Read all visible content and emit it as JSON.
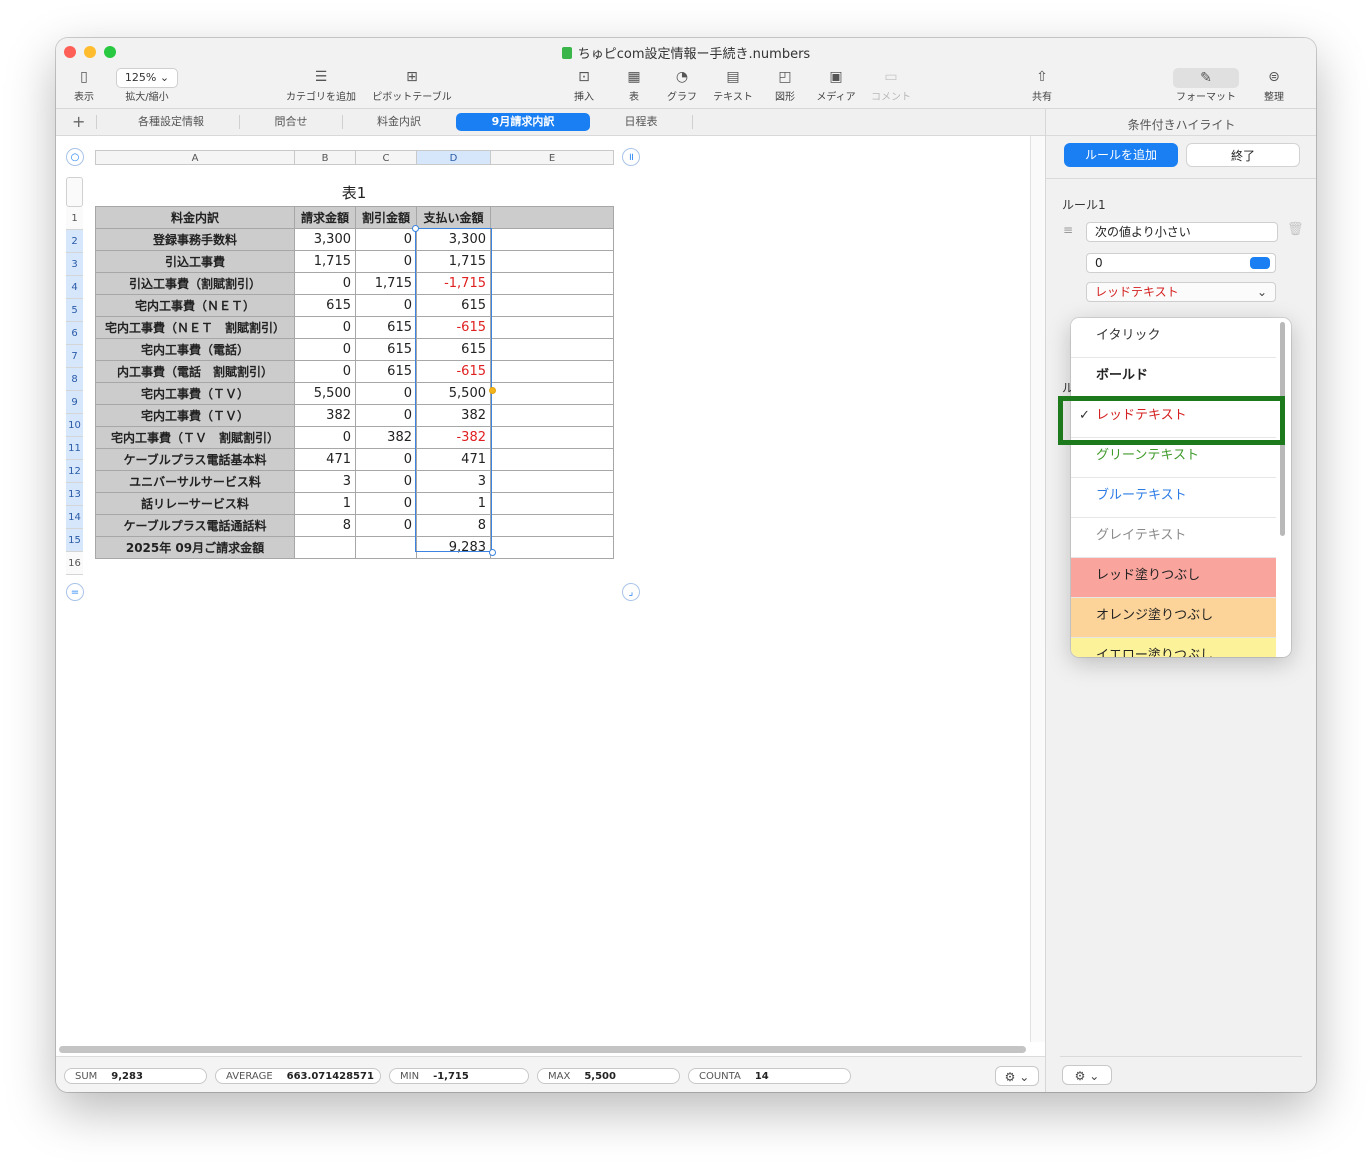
{
  "window": {
    "title": "ちゅピcom設定情報ー手続き.numbers",
    "traffic_colors": [
      "#fe5f57",
      "#febc2e",
      "#28c840"
    ]
  },
  "toolbar": {
    "view": "表示",
    "zoom_value": "125%",
    "zoom_label": "拡大/縮小",
    "add_category": "カテゴリを追加",
    "pivot": "ピボットテーブル",
    "insert": "挿入",
    "table": "表",
    "graph": "グラフ",
    "text": "テキスト",
    "shape": "図形",
    "media": "メディア",
    "comment": "コメント",
    "share": "共有",
    "format": "フォーマット",
    "organize": "整理"
  },
  "tabs": {
    "add": "+",
    "items": [
      "各種設定情報",
      "問合せ",
      "料金内訳",
      "9月請求内訳",
      "日程表"
    ],
    "active_index": 3
  },
  "sheet": {
    "column_headers": [
      "A",
      "B",
      "C",
      "D",
      "E"
    ],
    "selected_column": "D",
    "row_numbers": [
      "1",
      "2",
      "3",
      "4",
      "5",
      "6",
      "7",
      "8",
      "9",
      "10",
      "11",
      "12",
      "13",
      "14",
      "15",
      "16"
    ],
    "selected_rows": [
      "2",
      "3",
      "4",
      "5",
      "6",
      "7",
      "8",
      "9",
      "10",
      "11",
      "12",
      "13",
      "14",
      "15"
    ],
    "table_title": "表1",
    "header": [
      "料金内訳",
      "請求金額",
      "割引金額",
      "支払い金額",
      ""
    ],
    "rows": [
      {
        "label": "登録事務手数料",
        "billed": "3,300",
        "discount": "0",
        "paid": "3,300",
        "paid_negative": false
      },
      {
        "label": "引込工事費",
        "billed": "1,715",
        "discount": "0",
        "paid": "1,715",
        "paid_negative": false
      },
      {
        "label": "引込工事費（割賦割引）",
        "billed": "0",
        "discount": "1,715",
        "paid": "-1,715",
        "paid_negative": true
      },
      {
        "label": "宅内工事費（ＮＥＴ）",
        "billed": "615",
        "discount": "0",
        "paid": "615",
        "paid_negative": false
      },
      {
        "label": "宅内工事費（ＮＥＴ　割賦割引）",
        "billed": "0",
        "discount": "615",
        "paid": "-615",
        "paid_negative": true
      },
      {
        "label": "宅内工事費（電話）",
        "billed": "0",
        "discount": "615",
        "paid": "615",
        "paid_negative": false
      },
      {
        "label": "内工事費（電話　割賦割引）",
        "billed": "0",
        "discount": "615",
        "paid": "-615",
        "paid_negative": true
      },
      {
        "label": "宅内工事費（ＴＶ）",
        "billed": "5,500",
        "discount": "0",
        "paid": "5,500",
        "paid_negative": false
      },
      {
        "label": "宅内工事費（ＴＶ）",
        "billed": "382",
        "discount": "0",
        "paid": "382",
        "paid_negative": false
      },
      {
        "label": "宅内工事費（ＴＶ　割賦割引）",
        "billed": "0",
        "discount": "382",
        "paid": "-382",
        "paid_negative": true
      },
      {
        "label": "ケーブルプラス電話基本料",
        "billed": "471",
        "discount": "0",
        "paid": "471",
        "paid_negative": false
      },
      {
        "label": "ユニバーサルサービス料",
        "billed": "3",
        "discount": "0",
        "paid": "3",
        "paid_negative": false
      },
      {
        "label": "話リレーサービス料",
        "billed": "1",
        "discount": "0",
        "paid": "1",
        "paid_negative": false
      },
      {
        "label": "ケーブルプラス電話通話料",
        "billed": "8",
        "discount": "0",
        "paid": "8",
        "paid_negative": false
      }
    ],
    "footer": {
      "label": "2025年 09月ご請求金額",
      "billed": "",
      "discount": "",
      "paid": "9,283"
    },
    "negative_color": "#e02020"
  },
  "status_bar": {
    "stats": [
      {
        "key": "SUM",
        "value": "9,283"
      },
      {
        "key": "AVERAGE",
        "value": "663.071428571"
      },
      {
        "key": "MIN",
        "value": "-1,715"
      },
      {
        "key": "MAX",
        "value": "5,500"
      },
      {
        "key": "COUNTA",
        "value": "14"
      }
    ]
  },
  "panel": {
    "title": "条件付きハイライト",
    "add_rule": "ルールを追加",
    "done": "終了",
    "rule_title": "ルール1",
    "condition": "次の値より小さい",
    "value": "0",
    "style": "レッドテキスト",
    "rule2_partial": "ル",
    "accent": "#1a7ff3"
  },
  "style_menu": {
    "items": [
      {
        "label": "イタリック",
        "color": "#333333",
        "bg": "#ffffff",
        "bold": false
      },
      {
        "label": "ボールド",
        "color": "#222222",
        "bg": "#ffffff",
        "bold": true
      },
      {
        "label": "レッドテキスト",
        "color": "#d42020",
        "bg": "#ffffff",
        "bold": false
      },
      {
        "label": "グリーンテキスト",
        "color": "#3f9a2a",
        "bg": "#ffffff",
        "bold": false
      },
      {
        "label": "ブルーテキスト",
        "color": "#2c7be5",
        "bg": "#ffffff",
        "bold": false
      },
      {
        "label": "グレイテキスト",
        "color": "#8a8a8a",
        "bg": "#ffffff",
        "bold": false
      },
      {
        "label": "レッド塗りつぶし",
        "color": "#222222",
        "bg": "#f9a59e",
        "bold": false
      },
      {
        "label": "オレンジ塗りつぶし",
        "color": "#222222",
        "bg": "#fcd49a",
        "bold": false
      },
      {
        "label": "イエロー塗りつぶし",
        "color": "#222222",
        "bg": "#fbf299",
        "bold": false
      }
    ],
    "checked_index": 2,
    "check_mark": "✓",
    "highlight_color": "#1c7a1c"
  }
}
